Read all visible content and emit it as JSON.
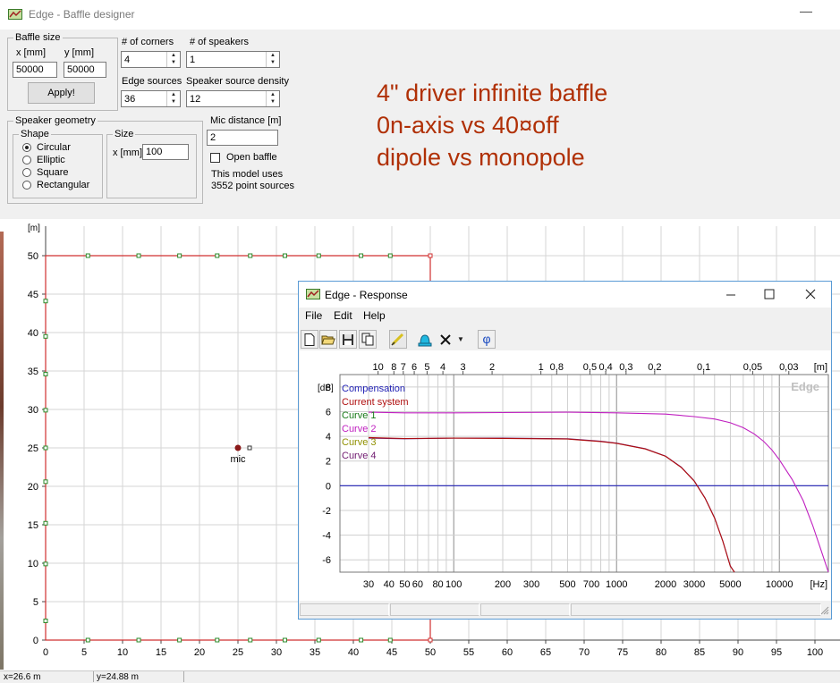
{
  "window": {
    "title": "Edge - Baffle designer",
    "minimize_glyph": "—"
  },
  "baffle_size": {
    "legend": "Baffle size",
    "x_label": "x [mm]",
    "y_label": "y [mm]",
    "x_value": "50000",
    "y_value": "50000",
    "apply_label": "Apply!"
  },
  "corners": {
    "label": "# of corners",
    "value": "4"
  },
  "speakers": {
    "label": "# of speakers",
    "value": "1"
  },
  "edge_sources": {
    "label": "Edge sources",
    "value": "36"
  },
  "density": {
    "label": "Speaker source density",
    "value": "12"
  },
  "mic": {
    "label": "Mic distance [m]",
    "value": "2",
    "open_baffle_label": "Open baffle",
    "open_baffle_checked": false,
    "model_line1": "This model uses",
    "model_line2": "3552 point sources"
  },
  "geometry": {
    "legend": "Speaker geometry",
    "shape_legend": "Shape",
    "shapes": [
      "Circular",
      "Elliptic",
      "Square",
      "Rectangular"
    ],
    "selected_shape": "Circular",
    "size_legend": "Size",
    "size_label": "x [mm]",
    "size_value": "100"
  },
  "annotation": {
    "line1": "4\" driver infinite baffle",
    "line2": "0n-axis vs 40¤off",
    "line3": "dipole vs monopole"
  },
  "baffle_plot": {
    "y_unit": "[m]",
    "x_ticks": [
      "5",
      "10",
      "15",
      "20",
      "25",
      "30",
      "35",
      "40",
      "45",
      "50",
      "55",
      "60",
      "65",
      "70",
      "75",
      "80",
      "85",
      "90",
      "95",
      "100"
    ],
    "y_ticks": [
      "50",
      "45",
      "40",
      "35",
      "30",
      "25",
      "20",
      "15",
      "10",
      "5",
      "0"
    ],
    "x_zero": "0",
    "mic_label": "mic",
    "mic_position": [
      25,
      25
    ],
    "baffle_corners": [
      [
        0,
        0
      ],
      [
        50,
        0
      ],
      [
        50,
        50
      ],
      [
        0,
        50
      ]
    ],
    "colors": {
      "outline": "#d03030",
      "nodes": "#2a8a2a",
      "mic": "#8b1a1a",
      "grid": "#d6d6d6"
    }
  },
  "status": {
    "x": "x=26.6 m",
    "y": "y=24.88 m"
  },
  "response": {
    "title": "Edge - Response",
    "menu": [
      "File",
      "Edit",
      "Help"
    ],
    "toolbar_icons": [
      "new-icon",
      "open-icon",
      "save-icon",
      "copy-icon",
      "pen-icon",
      "bell-icon",
      "delete-icon",
      "dropdown-arrow-icon",
      "phase-icon"
    ],
    "phase_glyph": "φ",
    "watermark": "Edge",
    "chart_data": {
      "type": "line",
      "x_scale": "log",
      "xlim": [
        20,
        20000
      ],
      "ylim": [
        -7,
        9
      ],
      "ylabel": "[dB]",
      "xlabel": "[Hz]",
      "top_axis_label": "[m]",
      "x_ticks": [
        {
          "v": 30,
          "t": "30"
        },
        {
          "v": 40,
          "t": "40"
        },
        {
          "v": 50,
          "t": "50"
        },
        {
          "v": 60,
          "t": "60"
        },
        {
          "v": 80,
          "t": "80"
        },
        {
          "v": 100,
          "t": "100"
        },
        {
          "v": 200,
          "t": "200"
        },
        {
          "v": 300,
          "t": "300"
        },
        {
          "v": 500,
          "t": "500"
        },
        {
          "v": 700,
          "t": "700"
        },
        {
          "v": 1000,
          "t": "1000"
        },
        {
          "v": 2000,
          "t": "2000"
        },
        {
          "v": 3000,
          "t": "3000"
        },
        {
          "v": 5000,
          "t": "5000"
        },
        {
          "v": 10000,
          "t": "10000"
        }
      ],
      "top_ticks": [
        {
          "v": 34.3,
          "t": "10"
        },
        {
          "v": 42.9,
          "t": "8"
        },
        {
          "v": 49,
          "t": "7"
        },
        {
          "v": 57.2,
          "t": "6"
        },
        {
          "v": 68.6,
          "t": "5"
        },
        {
          "v": 85.8,
          "t": "4"
        },
        {
          "v": 114,
          "t": "3"
        },
        {
          "v": 172,
          "t": "2"
        },
        {
          "v": 343,
          "t": "1"
        },
        {
          "v": 429,
          "t": "0,8"
        },
        {
          "v": 686,
          "t": "0,5"
        },
        {
          "v": 858,
          "t": "0,4"
        },
        {
          "v": 1144,
          "t": "0,3"
        },
        {
          "v": 1715,
          "t": "0,2"
        },
        {
          "v": 3430,
          "t": "0,1"
        },
        {
          "v": 6860,
          "t": "0,05"
        },
        {
          "v": 11430,
          "t": "0,03"
        }
      ],
      "y_ticks": [
        8,
        6,
        4,
        2,
        0,
        -2,
        -4,
        -6
      ],
      "y_tick_labels": [
        "8",
        "6",
        "4",
        "2",
        "0",
        "-2",
        "-4",
        "-6"
      ],
      "legend": [
        {
          "name": "Compensation",
          "color": "#1f1fb4"
        },
        {
          "name": "Current system",
          "color": "#b01010"
        },
        {
          "name": "Curve 1",
          "color": "#1a7a1a"
        },
        {
          "name": "Curve 2",
          "color": "#c020c0"
        },
        {
          "name": "Curve 3",
          "color": "#909000"
        },
        {
          "name": "Curve 4",
          "color": "#701a70"
        }
      ],
      "series": [
        {
          "name": "Compensation",
          "color": "#1f1fb4",
          "x": [
            20,
            20000
          ],
          "y": [
            0,
            0
          ]
        },
        {
          "name": "Curve 2",
          "color": "#c020c0",
          "x": [
            30,
            50,
            100,
            200,
            500,
            1000,
            2000,
            3000,
            4000,
            5000,
            6000,
            7000,
            8000,
            9000,
            10000,
            12000,
            14000,
            16000,
            18000,
            20000
          ],
          "y": [
            5.95,
            5.9,
            5.9,
            5.92,
            5.95,
            5.9,
            5.8,
            5.6,
            5.4,
            5.1,
            4.7,
            4.2,
            3.6,
            2.9,
            2.1,
            0.5,
            -1.2,
            -3.2,
            -5.2,
            -7
          ]
        },
        {
          "name": "Curve 4",
          "color": "#701a70",
          "x": [
            30,
            50,
            100,
            200,
            500,
            800,
            1000,
            1500,
            2000,
            2500,
            3000,
            3500,
            4000,
            4500,
            5000,
            5300
          ],
          "y": [
            3.85,
            3.8,
            3.85,
            3.85,
            3.8,
            3.6,
            3.45,
            3.0,
            2.4,
            1.5,
            0.4,
            -1.0,
            -2.6,
            -4.5,
            -6.5,
            -7
          ]
        },
        {
          "name": "Current system",
          "color": "#b01010",
          "x": [
            30,
            50,
            100,
            200,
            500,
            800,
            1000,
            1500,
            2000,
            2500,
            3000,
            3500,
            4000,
            4500,
            5000,
            5300
          ],
          "y": [
            3.9,
            3.82,
            3.85,
            3.83,
            3.78,
            3.58,
            3.43,
            2.98,
            2.38,
            1.48,
            0.38,
            -1.02,
            -2.62,
            -4.52,
            -6.52,
            -7
          ]
        }
      ]
    }
  }
}
